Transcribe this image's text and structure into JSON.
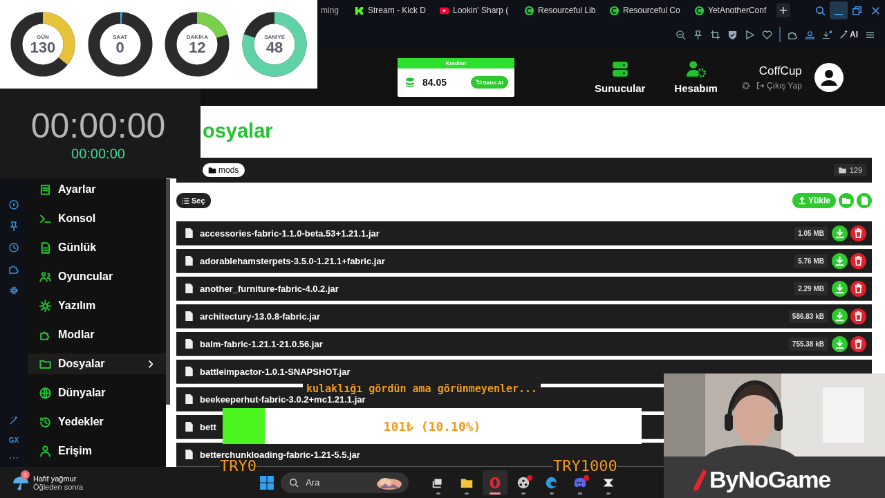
{
  "browser": {
    "tabs": [
      {
        "title": "ming",
        "kind": "plain"
      },
      {
        "title": "Stream - Kick D",
        "kind": "kick"
      },
      {
        "title": "Lookin' Sharp (",
        "kind": "video"
      },
      {
        "title": "Resourceful Lib",
        "kind": "mod"
      },
      {
        "title": "Resourceful Co",
        "kind": "mod"
      },
      {
        "title": "YetAnotherConf",
        "kind": "mod"
      }
    ],
    "ai_label": "AI",
    "rail_label": "GX",
    "rail_more": "⋯"
  },
  "countdown": [
    {
      "label": "GÜN",
      "value": "130",
      "level": 0.36,
      "color": "#e5c33a"
    },
    {
      "label": "SAAT",
      "value": "0",
      "level": 0.01,
      "color": "#3fa9e0"
    },
    {
      "label": "DAKİKA",
      "value": "12",
      "level": 0.2,
      "color": "#7bd04a"
    },
    {
      "label": "SANİYE",
      "value": "48",
      "level": 0.8,
      "color": "#5fd3a7"
    }
  ],
  "timer": {
    "main": "00:00:00",
    "sub": "00:00:00"
  },
  "header": {
    "credits": {
      "title": "Krediler",
      "amount": "84.05",
      "buy": "Satın Al"
    },
    "nav": [
      {
        "label": "Sunucular",
        "kind": "servers"
      },
      {
        "label": "Hesabım",
        "kind": "account"
      }
    ],
    "user": {
      "name": "CoffCup",
      "logout": "Çıkış Yap"
    }
  },
  "sidebar": {
    "items": [
      {
        "label": "Ayarlar",
        "kind": "settings",
        "selected": false
      },
      {
        "label": "Konsol",
        "kind": "console",
        "selected": false
      },
      {
        "label": "Günlük",
        "kind": "log",
        "selected": false
      },
      {
        "label": "Oyuncular",
        "kind": "players",
        "selected": false
      },
      {
        "label": "Yazılım",
        "kind": "software",
        "selected": false
      },
      {
        "label": "Modlar",
        "kind": "mods",
        "selected": false
      },
      {
        "label": "Dosyalar",
        "kind": "files",
        "selected": true
      },
      {
        "label": "Dünyalar",
        "kind": "worlds",
        "selected": false
      },
      {
        "label": "Yedekler",
        "kind": "backups",
        "selected": false
      },
      {
        "label": "Erişim",
        "kind": "access",
        "selected": false
      }
    ]
  },
  "page": {
    "title": "osyalar",
    "path": "mods",
    "count": "129",
    "select": "Seç",
    "upload": "Yükle"
  },
  "files": [
    {
      "name": "accessories-fabric-1.1.0-beta.53+1.21.1.jar",
      "size": "1.05 MB"
    },
    {
      "name": "adorablehamsterpets-3.5.0-1.21.1+fabric.jar",
      "size": "5.76 MB"
    },
    {
      "name": "another_furniture-fabric-4.0.2.jar",
      "size": "2.29 MB"
    },
    {
      "name": "architectury-13.0.8-fabric.jar",
      "size": "586.83 kB"
    },
    {
      "name": "balm-fabric-1.21.1-21.0.56.jar",
      "size": "755.38 kB"
    },
    {
      "name": "battleimpactor-1.0.1-SNAPSHOT.jar"
    },
    {
      "name": "beekeeperhut-fabric-3.0.2+mc1.21.1.jar"
    },
    {
      "name": "bett"
    },
    {
      "name": "betterchunkloading-fabric-1.21-5.5.jar"
    }
  ],
  "donation": {
    "message": "kulaklığı gördün ama görünmeyenler...",
    "level": 0.101,
    "amount": "101₺ (10.10%)",
    "min": "TRY0",
    "max": "TRY1000"
  },
  "webcam": {
    "kind": "picture",
    "logo": "ByNoGame"
  },
  "taskbar": {
    "weather": {
      "badge": "3",
      "title": "Hafif yağmur",
      "subtitle": "Öğleden sonra"
    },
    "search": {
      "placeholder": "Ara"
    },
    "apps": [
      {
        "kind": "taskview",
        "selected": false,
        "alert": false
      },
      {
        "kind": "explorer",
        "selected": false,
        "alert": false
      },
      {
        "kind": "opera",
        "selected": true,
        "alert": false
      },
      {
        "kind": "obs",
        "selected": false,
        "alert": true
      },
      {
        "kind": "edge",
        "selected": false,
        "alert": false
      },
      {
        "kind": "discord",
        "selected": false,
        "alert": true
      },
      {
        "kind": "capcut",
        "selected": false,
        "alert": false
      }
    ]
  }
}
